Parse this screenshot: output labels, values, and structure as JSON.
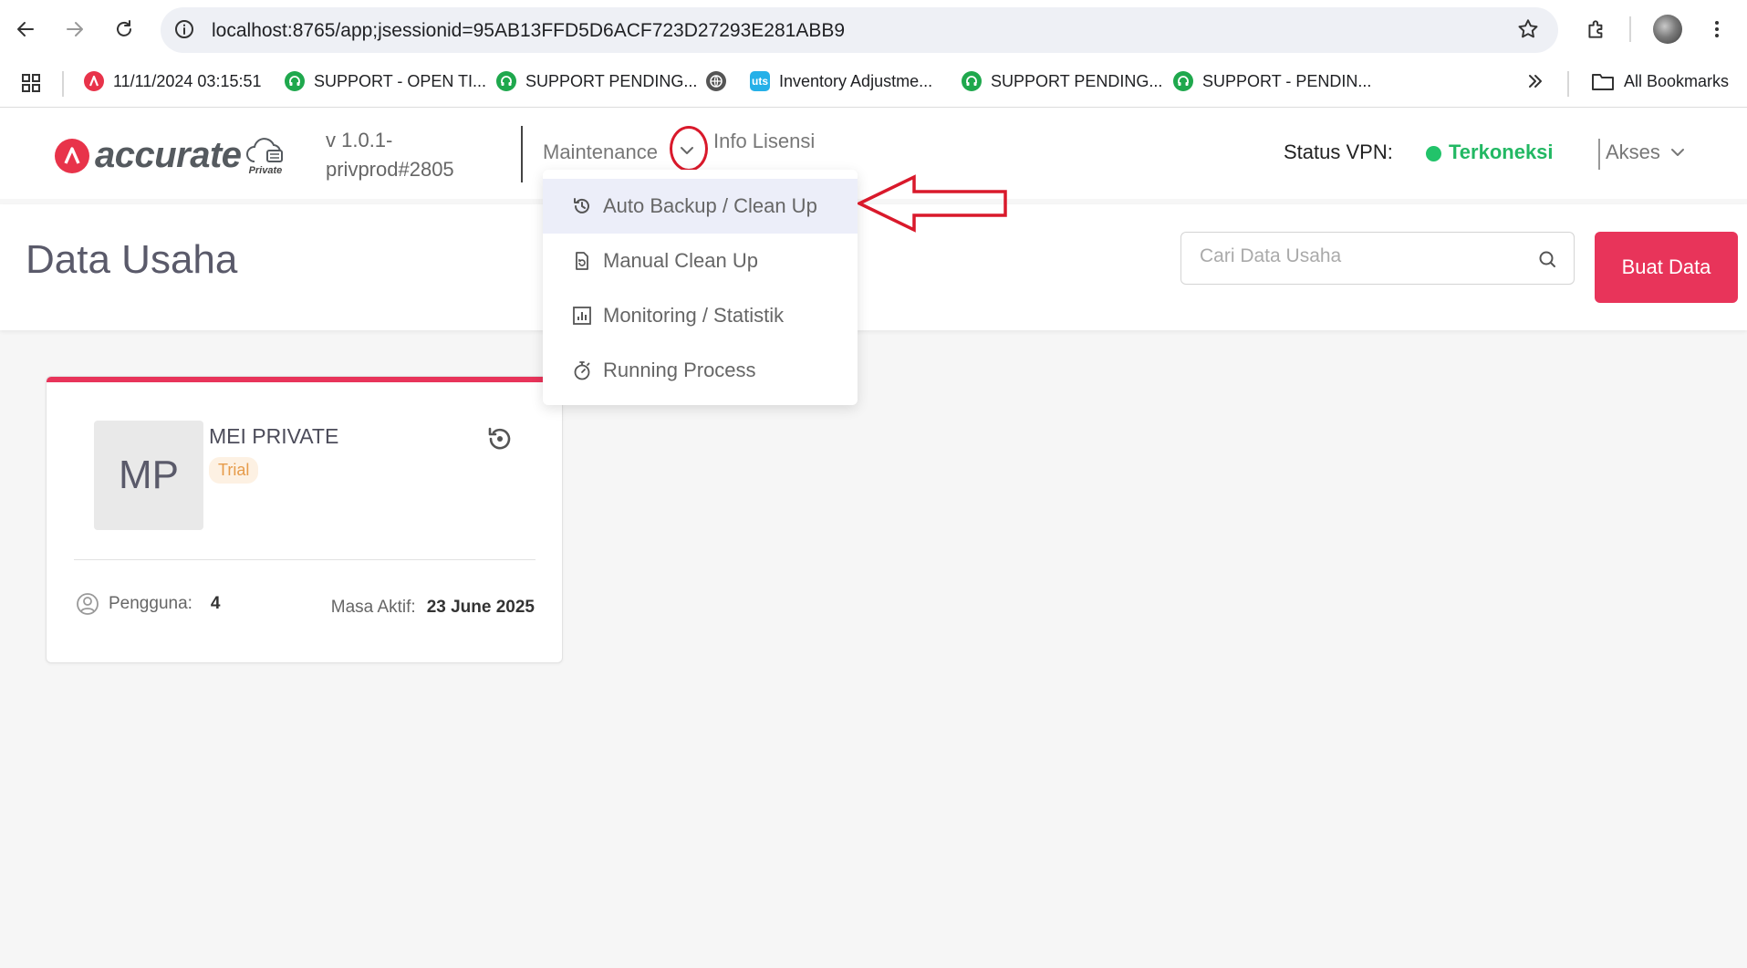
{
  "browser": {
    "url": "localhost:8765/app;jsessionid=95AB13FFD5D6ACF723D27293E281ABB9",
    "bookmarks": [
      {
        "label": "11/11/2024 03:15:51",
        "icon": "accurate-icon",
        "color": "#e8334a"
      },
      {
        "label": "SUPPORT - OPEN TI...",
        "icon": "headset-icon",
        "color": "#1fa84d"
      },
      {
        "label": "SUPPORT PENDING...",
        "icon": "headset-icon",
        "color": "#1fa84d"
      },
      {
        "label": "",
        "icon": "globe-icon",
        "color": "#555555"
      },
      {
        "label": "Inventory Adjustme...",
        "icon": "uts-icon",
        "color": "#25b0e8"
      },
      {
        "label": "SUPPORT PENDING...",
        "icon": "headset-icon",
        "color": "#1fa84d"
      },
      {
        "label": "SUPPORT - PENDIN...",
        "icon": "headset-icon",
        "color": "#1fa84d"
      }
    ],
    "all_bookmarks": "All Bookmarks"
  },
  "header": {
    "logo_text": "accurate",
    "logo_sub": "Private",
    "version": "v 1.0.1-privprod#2805",
    "menu_maintenance": "Maintenance",
    "menu_info": "Info Lisensi",
    "vpn_label": "Status VPN:",
    "vpn_status": "Terkoneksi",
    "vpn_color": "#22c36a",
    "akses": "Akses"
  },
  "dropdown": {
    "items": [
      {
        "label": "Auto Backup / Clean Up",
        "icon": "history-icon",
        "active": true
      },
      {
        "label": "Manual Clean Up",
        "icon": "document-refresh-icon",
        "active": false
      },
      {
        "label": "Monitoring / Statistik",
        "icon": "chart-icon",
        "active": false
      },
      {
        "label": "Running Process",
        "icon": "stopwatch-icon",
        "active": false
      }
    ]
  },
  "page": {
    "title": "Data Usaha",
    "search_placeholder": "Cari Data Usaha",
    "create_button": "Buat Data",
    "accent_color": "#e8345a"
  },
  "card": {
    "initials": "MP",
    "name": "MEI PRIVATE",
    "badge": "Trial",
    "users_label": "Pengguna:",
    "users_count": "4",
    "active_label": "Masa Aktif:",
    "active_until": "23 June 2025"
  }
}
